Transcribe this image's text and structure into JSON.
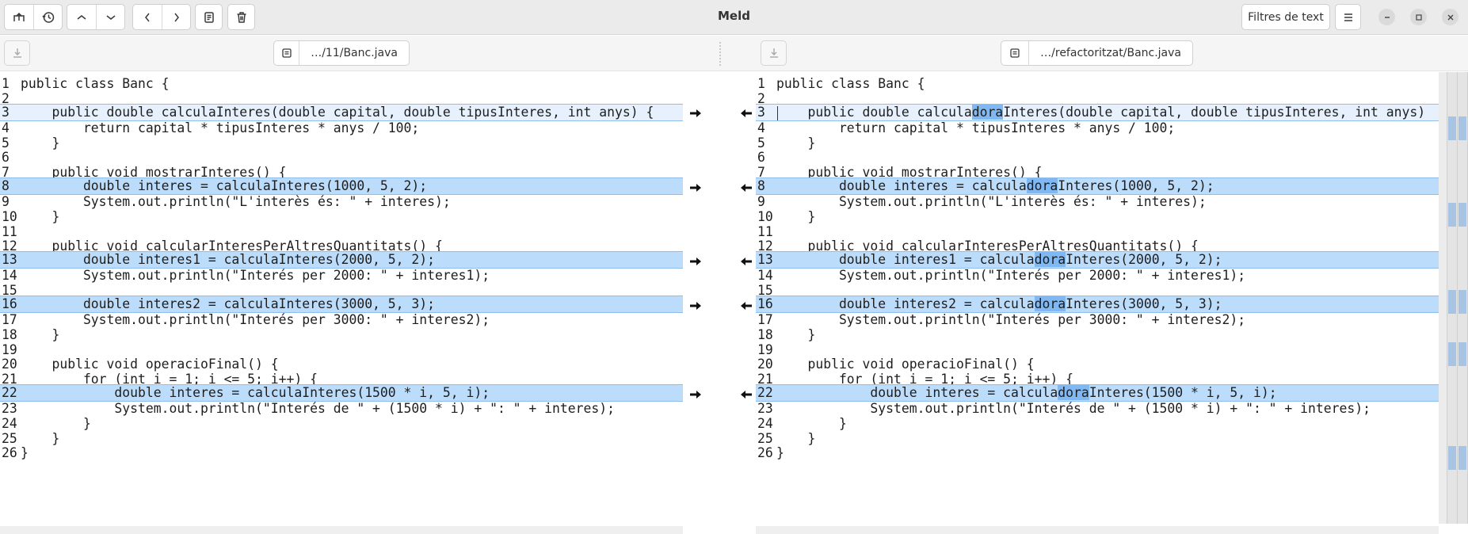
{
  "app": {
    "title": "Meld"
  },
  "toolbar": {
    "buttons": [
      "new-comparison-icon",
      "history-icon",
      "prev-change-icon",
      "next-change-icon",
      "prev-conflict-icon",
      "next-conflict-icon",
      "copy-icon",
      "delete-icon"
    ],
    "filters_label": "Filtres de text",
    "menu_icon": "hamburger-menu-icon",
    "window_controls": [
      "minimize-icon",
      "maximize-icon",
      "close-icon"
    ]
  },
  "files": {
    "left": {
      "name": "…/11/Banc.java"
    },
    "right": {
      "name": "…/refactoritzat/Banc.java"
    }
  },
  "colors": {
    "changed_line": "#bcdcfb",
    "inline_highlight": "#7fb8f2",
    "border": "#8fbdee"
  },
  "left": {
    "lines": [
      {
        "num": "1",
        "code": "public class Banc {",
        "state": "normal"
      },
      {
        "num": "2",
        "code": "",
        "state": "normal"
      },
      {
        "num": "3",
        "code": "    public double calculaInteres(double capital, double tipusInteres, int anys) {",
        "state": "cursor"
      },
      {
        "num": "4",
        "code": "        return capital * tipusInteres * anys / 100;",
        "state": "normal"
      },
      {
        "num": "5",
        "code": "    }",
        "state": "normal"
      },
      {
        "num": "6",
        "code": "",
        "state": "normal"
      },
      {
        "num": "7",
        "code": "    public void mostrarInteres() {",
        "state": "normal"
      },
      {
        "num": "8",
        "code": "        double interes = calculaInteres(1000, 5, 2);",
        "state": "changed"
      },
      {
        "num": "9",
        "code": "        System.out.println(\"L'interès és: \" + interes);",
        "state": "normal"
      },
      {
        "num": "10",
        "code": "    }",
        "state": "normal"
      },
      {
        "num": "11",
        "code": "",
        "state": "normal"
      },
      {
        "num": "12",
        "code": "    public void calcularInteresPerAltresQuantitats() {",
        "state": "normal"
      },
      {
        "num": "13",
        "code": "        double interes1 = calculaInteres(2000, 5, 2);",
        "state": "changed"
      },
      {
        "num": "14",
        "code": "        System.out.println(\"Interés per 2000: \" + interes1);",
        "state": "normal"
      },
      {
        "num": "15",
        "code": "",
        "state": "normal"
      },
      {
        "num": "16",
        "code": "        double interes2 = calculaInteres(3000, 5, 3);",
        "state": "changed"
      },
      {
        "num": "17",
        "code": "        System.out.println(\"Interés per 3000: \" + interes2);",
        "state": "normal"
      },
      {
        "num": "18",
        "code": "    }",
        "state": "normal"
      },
      {
        "num": "19",
        "code": "",
        "state": "normal"
      },
      {
        "num": "20",
        "code": "    public void operacioFinal() {",
        "state": "normal"
      },
      {
        "num": "21",
        "code": "        for (int i = 1; i <= 5; i++) {",
        "state": "normal"
      },
      {
        "num": "22",
        "code": "            double interes = calculaInteres(1500 * i, 5, i);",
        "state": "changed"
      },
      {
        "num": "23",
        "code": "            System.out.println(\"Interés de \" + (1500 * i) + \": \" + interes);",
        "state": "normal"
      },
      {
        "num": "24",
        "code": "        }",
        "state": "normal"
      },
      {
        "num": "25",
        "code": "    }",
        "state": "normal"
      },
      {
        "num": "26",
        "code": "}",
        "state": "normal"
      }
    ]
  },
  "right": {
    "lines": [
      {
        "num": "1",
        "code": "public class Banc {",
        "state": "normal"
      },
      {
        "num": "2",
        "code": "",
        "state": "normal"
      },
      {
        "num": "3",
        "pre": "    public double calcula",
        "hl": "dora",
        "post": "Interes(double capital, double tipusInteres, int anys)",
        "state": "cursor"
      },
      {
        "num": "4",
        "code": "        return capital * tipusInteres * anys / 100;",
        "state": "normal"
      },
      {
        "num": "5",
        "code": "    }",
        "state": "normal"
      },
      {
        "num": "6",
        "code": "",
        "state": "normal"
      },
      {
        "num": "7",
        "code": "    public void mostrarInteres() {",
        "state": "normal"
      },
      {
        "num": "8",
        "pre": "        double interes = calcula",
        "hl": "dora",
        "post": "Interes(1000, 5, 2);",
        "state": "changed"
      },
      {
        "num": "9",
        "code": "        System.out.println(\"L'interès és: \" + interes);",
        "state": "normal"
      },
      {
        "num": "10",
        "code": "    }",
        "state": "normal"
      },
      {
        "num": "11",
        "code": "",
        "state": "normal"
      },
      {
        "num": "12",
        "code": "    public void calcularInteresPerAltresQuantitats() {",
        "state": "normal"
      },
      {
        "num": "13",
        "pre": "        double interes1 = calcula",
        "hl": "dora",
        "post": "Interes(2000, 5, 2);",
        "state": "changed"
      },
      {
        "num": "14",
        "code": "        System.out.println(\"Interés per 2000: \" + interes1);",
        "state": "normal"
      },
      {
        "num": "15",
        "code": "",
        "state": "normal"
      },
      {
        "num": "16",
        "pre": "        double interes2 = calcula",
        "hl": "dora",
        "post": "Interes(3000, 5, 3);",
        "state": "changed"
      },
      {
        "num": "17",
        "code": "        System.out.println(\"Interés per 3000: \" + interes2);",
        "state": "normal"
      },
      {
        "num": "18",
        "code": "    }",
        "state": "normal"
      },
      {
        "num": "19",
        "code": "",
        "state": "normal"
      },
      {
        "num": "20",
        "code": "    public void operacioFinal() {",
        "state": "normal"
      },
      {
        "num": "21",
        "code": "        for (int i = 1; i <= 5; i++) {",
        "state": "normal"
      },
      {
        "num": "22",
        "pre": "            double interes = calcula",
        "hl": "dora",
        "post": "Interes(1500 * i, 5, i);",
        "state": "changed"
      },
      {
        "num": "23",
        "code": "            System.out.println(\"Interés de \" + (1500 * i) + \": \" + interes);",
        "state": "normal"
      },
      {
        "num": "24",
        "code": "        }",
        "state": "normal"
      },
      {
        "num": "25",
        "code": "    }",
        "state": "normal"
      },
      {
        "num": "26",
        "code": "}",
        "state": "normal"
      }
    ]
  },
  "linkmap": {
    "chunk_lines": [
      "3",
      "8",
      "13",
      "16",
      "22"
    ]
  }
}
